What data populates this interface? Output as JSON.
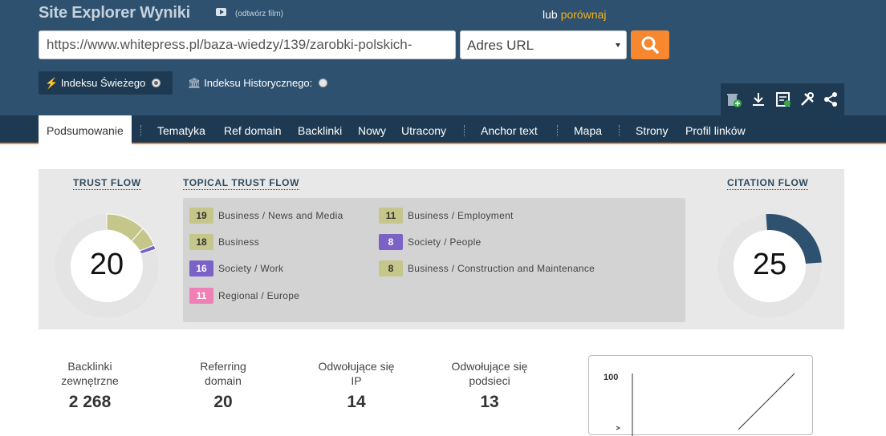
{
  "header": {
    "title": "Site Explorer Wyniki",
    "film_link": "(odtwórz film)",
    "lub": "lub",
    "compare_link": "porównaj"
  },
  "search": {
    "url_value": "https://www.whitepress.pl/baza-wiedzy/139/zarobki-polskich-",
    "mode_selected": "Adres URL"
  },
  "index": {
    "fresh_label": "Indeksu Świeżego",
    "historic_label": "Indeksu Historycznego:"
  },
  "toolbar_icons": [
    "add-bucket-icon",
    "download-icon",
    "report-icon",
    "tools-icon",
    "share-icon"
  ],
  "nav": {
    "tabs": [
      "Podsumowanie",
      "Tematyka",
      "Ref domain",
      "Backlinki",
      "Nowy",
      "Utracony",
      "Anchor text",
      "Mapa",
      "Strony",
      "Profil linków"
    ],
    "active": "Podsumowanie"
  },
  "trust_flow": {
    "label": "TRUST FLOW",
    "value": "20"
  },
  "citation_flow": {
    "label": "CITATION FLOW",
    "value": "25"
  },
  "topical": {
    "label": "TOPICAL TRUST FLOW",
    "items": [
      {
        "score": "19",
        "topic": "Business / News and Media",
        "color": "#c5c68a"
      },
      {
        "score": "18",
        "topic": "Business",
        "color": "#c5c68a"
      },
      {
        "score": "16",
        "topic": "Society / Work",
        "color": "#7a62c7"
      },
      {
        "score": "11",
        "topic": "Regional / Europe",
        "color": "#ef80b5"
      },
      {
        "score": "11",
        "topic": "Business / Employment",
        "color": "#c5c68a"
      },
      {
        "score": "8",
        "topic": "Society / People",
        "color": "#7a62c7"
      },
      {
        "score": "8",
        "topic": "Business / Construction and Maintenance",
        "color": "#c5c68a"
      }
    ]
  },
  "stats": [
    {
      "label1": "Backlinki",
      "label2": "zewnętrzne",
      "value": "2 268"
    },
    {
      "label1": "Referring",
      "label2": "domain",
      "value": "20"
    },
    {
      "label1": "Odwołujące się",
      "label2": "IP",
      "value": "14"
    },
    {
      "label1": "Odwołujące się",
      "label2": "podsieci",
      "value": "13"
    }
  ],
  "mini_chart": {
    "y_tick": "100"
  },
  "colors": {
    "topbar": "#2e5170",
    "nav": "#1d3a52",
    "accent": "#f7882f",
    "citation": "#2e5170"
  }
}
